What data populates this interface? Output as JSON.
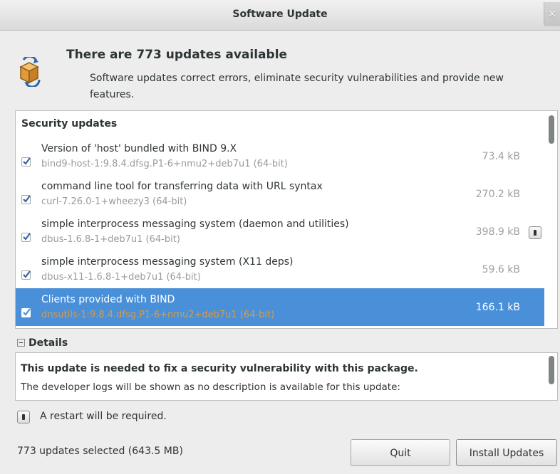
{
  "window": {
    "title": "Software Update",
    "close_glyph": "×"
  },
  "header": {
    "title": "There are 773 updates available",
    "description": "Software updates correct errors, eliminate security vulnerabilities and provide new features.",
    "icon": "package-update-icon"
  },
  "updates": {
    "section_title": "Security updates",
    "items": [
      {
        "summary": "Version of 'host' bundled with BIND 9.X",
        "package": "bind9-host-1:9.8.4.dfsg.P1-6+nmu2+deb7u1 (64-bit)",
        "size": "73.4 kB",
        "checked": true,
        "selected": false,
        "restart": false
      },
      {
        "summary": "command line tool for transferring data with URL syntax",
        "package": "curl-7.26.0-1+wheezy3 (64-bit)",
        "size": "270.2 kB",
        "checked": true,
        "selected": false,
        "restart": false
      },
      {
        "summary": "simple interprocess messaging system (daemon and utilities)",
        "package": "dbus-1.6.8-1+deb7u1 (64-bit)",
        "size": "398.9 kB",
        "checked": true,
        "selected": false,
        "restart": true
      },
      {
        "summary": "simple interprocess messaging system (X11 deps)",
        "package": "dbus-x11-1.6.8-1+deb7u1 (64-bit)",
        "size": "59.6 kB",
        "checked": true,
        "selected": false,
        "restart": false
      },
      {
        "summary": "Clients provided with BIND",
        "package": "dnsutils-1:9.8.4.dfsg.P1-6+nmu2+deb7u1 (64-bit)",
        "size": "166.1 kB",
        "checked": true,
        "selected": true,
        "restart": false
      }
    ]
  },
  "details": {
    "toggle_label": "Details",
    "heading": "This update is needed to fix a security vulnerability with this package.",
    "body": "The developer logs will be shown as no description is available for this update:"
  },
  "restart_notice": "A restart will be required.",
  "footer": {
    "selected_summary": "773 updates selected (643.5 MB)",
    "quit_label": "Quit",
    "install_label": "Install Updates"
  },
  "colors": {
    "selection": "#4a90d9",
    "selected_package_text": "#d69b4a"
  }
}
